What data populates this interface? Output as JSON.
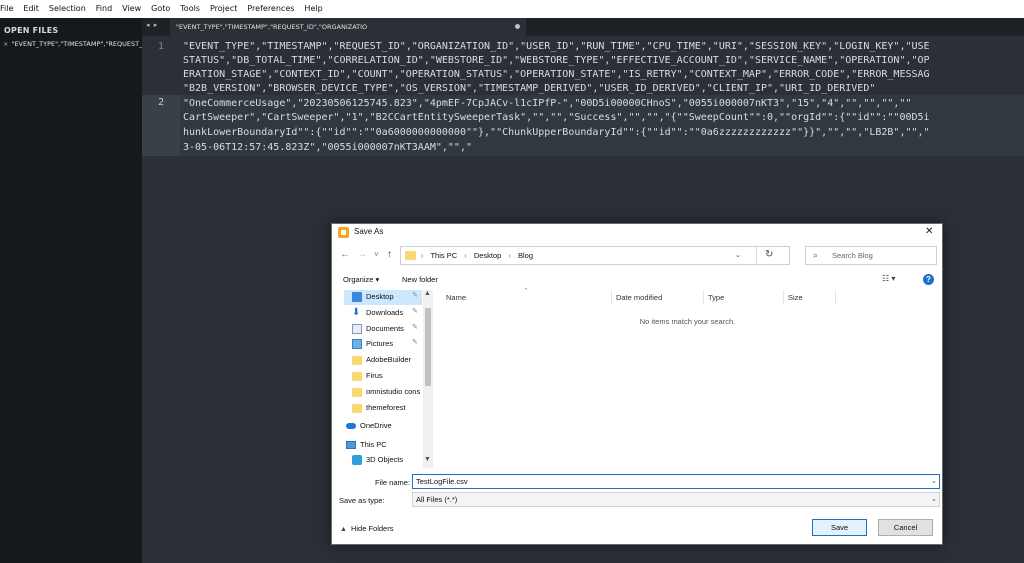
{
  "menu": [
    "File",
    "Edit",
    "Selection",
    "Find",
    "View",
    "Goto",
    "Tools",
    "Project",
    "Preferences",
    "Help"
  ],
  "sidebar": {
    "header": "OPEN FILES",
    "file_close": "×",
    "file": "\"EVENT_TYPE\",\"TIMESTAMP\",\"REQUEST_"
  },
  "tabbar": {
    "nav_arrows": "◂ ▸",
    "tab_title": "\"EVENT_TYPE\",\"TIMESTAMP\",\"REQUEST_ID\",\"ORGANIZATIO"
  },
  "editor": {
    "line_numbers": [
      "1",
      "2"
    ],
    "lines": [
      "\"EVENT_TYPE\",\"TIMESTAMP\",\"REQUEST_ID\",\"ORGANIZATION_ID\",\"USER_ID\",\"RUN_TIME\",\"CPU_TIME\",\"URI\",\"SESSION_KEY\",\"LOGIN_KEY\",\"USE",
      "STATUS\",\"DB_TOTAL_TIME\",\"CORRELATION_ID\",\"WEBSTORE_ID\",\"WEBSTORE_TYPE\",\"EFFECTIVE_ACCOUNT_ID\",\"SERVICE_NAME\",\"OPERATION\",\"OP",
      "ERATION_STAGE\",\"CONTEXT_ID\",\"COUNT\",\"OPERATION_STATUS\",\"OPERATION_STATE\",\"IS_RETRY\",\"CONTEXT_MAP\",\"ERROR_CODE\",\"ERROR_MESSAG",
      "\"B2B_VERSION\",\"BROWSER_DEVICE_TYPE\",\"OS_VERSION\",\"TIMESTAMP_DERIVED\",\"USER_ID_DERIVED\",\"CLIENT_IP\",\"URI_ID_DERIVED\"",
      "\"OneCommerceUsage\",\"20230506125745.823\",\"4pmEF-7CpJACv-l1cIPfP-\",\"00D5i00000CHnoS\",\"0055i000007nKT3\",\"15\",\"4\",\"\",\"\",\"\",\"\"",
      "CartSweeper\",\"CartSweeper\",\"1\",\"B2CCartEntitySweeperTask\",\"\",\"\",\"Success\",\"\",\"\",\"{\"\"SweepCount\"\":0,\"\"orgId\"\":{\"\"id\"\":\"\"00D5i",
      "hunkLowerBoundaryId\"\":{\"\"id\"\":\"\"0a6000000000000\"\"},\"\"ChunkUpperBoundaryId\"\":{\"\"id\"\":\"\"0a6zzzzzzzzzzzz\"\"}}\",\"\",\"\",\"LB2B\",\"\",\"",
      "3-05-06T12:57:45.823Z\",\"0055i000007nKT3AAM\",\"\",\""
    ]
  },
  "dialog": {
    "title": "Save As",
    "close": "✕",
    "nav": {
      "back": "←",
      "forward": "→",
      "recent": "˅",
      "up": "↑"
    },
    "breadcrumb": [
      "This PC",
      "Desktop",
      "Blog"
    ],
    "breadcrumb_sep": "›",
    "search_placeholder": "Search Blog",
    "organize": "Organize ▾",
    "new_folder": "New folder",
    "view_icon": "☷ ▾",
    "help": "?",
    "nav_pane": [
      {
        "label": "Desktop",
        "icon": "desktop-icon",
        "pinned": true
      },
      {
        "label": "Downloads",
        "icon": "download-icon",
        "pinned": true
      },
      {
        "label": "Documents",
        "icon": "documents-icon",
        "pinned": true
      },
      {
        "label": "Pictures",
        "icon": "pictures-icon",
        "pinned": true
      },
      {
        "label": "AdobeBuilder",
        "icon": "folder-icon",
        "pinned": false
      },
      {
        "label": "Firus",
        "icon": "folder-icon",
        "pinned": false
      },
      {
        "label": "omnistudio cons",
        "icon": "folder-icon",
        "pinned": false
      },
      {
        "label": "themeforest",
        "icon": "folder-icon",
        "pinned": false
      },
      {
        "label": "OneDrive",
        "icon": "onedrive-icon",
        "pinned": false
      },
      {
        "label": "This PC",
        "icon": "this-pc-icon",
        "pinned": false
      },
      {
        "label": "3D Objects",
        "icon": "3d-objects-icon",
        "pinned": false
      }
    ],
    "columns": [
      "Name",
      "Date modified",
      "Type",
      "Size"
    ],
    "empty_message": "No items match your search.",
    "file_name_label": "File name:",
    "file_name_value": "TestLogFile.csv",
    "save_type_label": "Save as type:",
    "save_type_value": "All Files (*.*)",
    "hide_folders": "Hide Folders",
    "save_button": "Save",
    "cancel_button": "Cancel"
  }
}
